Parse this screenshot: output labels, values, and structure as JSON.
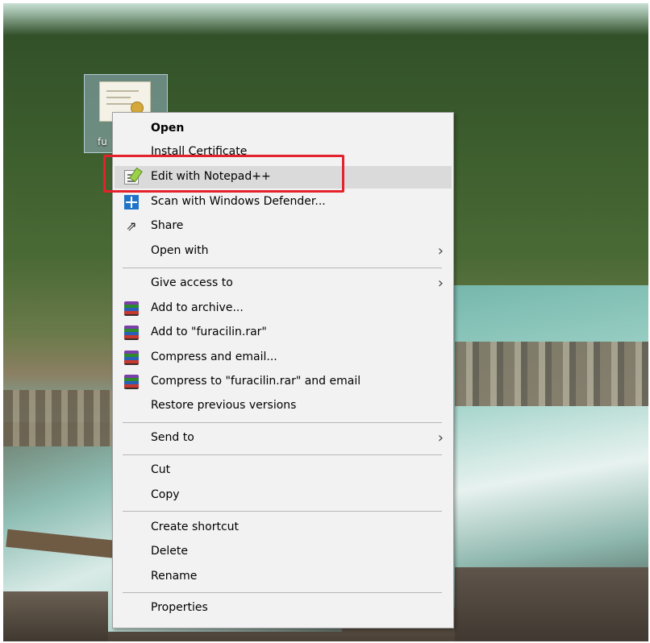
{
  "desktop": {
    "icon_label": "fu"
  },
  "menu": {
    "items": [
      {
        "label": "Open",
        "icon": "",
        "bold": true
      },
      {
        "label": "Install Certificate",
        "icon": ""
      },
      {
        "label": "Edit with Notepad++",
        "icon": "notepad-plus-plus-icon",
        "highlighted": true
      },
      {
        "label": "Scan with Windows Defender...",
        "icon": "windows-defender-icon"
      },
      {
        "label": "Share",
        "icon": "share-icon"
      },
      {
        "label": "Open with",
        "icon": "",
        "submenu": true
      },
      {
        "label": "Give access to",
        "icon": "",
        "submenu": true
      },
      {
        "label": "Add to archive...",
        "icon": "winrar-icon"
      },
      {
        "label": "Add to \"furacilin.rar\"",
        "icon": "winrar-icon"
      },
      {
        "label": "Compress and email...",
        "icon": "winrar-icon"
      },
      {
        "label": "Compress to \"furacilin.rar\" and email",
        "icon": "winrar-icon"
      },
      {
        "label": "Restore previous versions",
        "icon": ""
      },
      {
        "label": "Send to",
        "icon": "",
        "submenu": true
      },
      {
        "label": "Cut",
        "icon": ""
      },
      {
        "label": "Copy",
        "icon": ""
      },
      {
        "label": "Create shortcut",
        "icon": ""
      },
      {
        "label": "Delete",
        "icon": ""
      },
      {
        "label": "Rename",
        "icon": ""
      },
      {
        "label": "Properties",
        "icon": ""
      }
    ],
    "submenu_arrow": "›"
  },
  "colors": {
    "menu_background": "#f2f2f2",
    "hover_highlight": "#dadada",
    "annotation_box": "#e3222b"
  }
}
